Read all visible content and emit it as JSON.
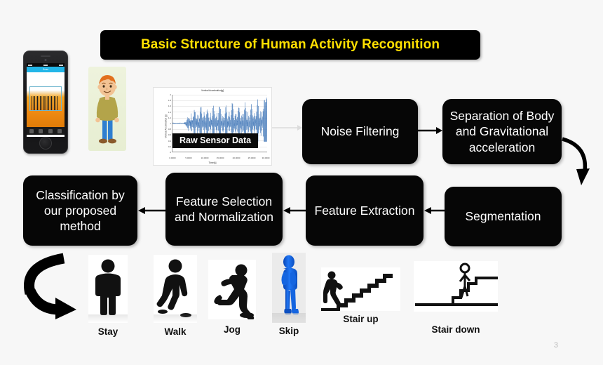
{
  "slide": {
    "title": "Basic Structure of Human Activity Recognition",
    "page_number": "3",
    "background_color": "#f7f7f7",
    "title_bar_color": "#000000",
    "title_text_color": "#ffe000",
    "box_color": "#060606",
    "box_text_color": "#ffffff"
  },
  "inputs": {
    "phone": {
      "name": "smartphone-barcode-scanner",
      "navbar_title": "Scan",
      "screen_bg": "#ffffff",
      "accent": "#23b6e8"
    },
    "person": {
      "name": "cartoon-person",
      "hair_color": "#e2701e",
      "shirt_color": "#b3a44a",
      "pants_color": "#2f7fd0",
      "skin_color": "#f2c394",
      "shoe_color": "#8a5a2b",
      "bg_color": "#e9efd4"
    }
  },
  "chart_data": {
    "type": "line",
    "title": "Vertical Acceleration[g]",
    "xlabel": "Time[s]",
    "ylabel": "Vertical Acceleration [g]",
    "overlay_label": "Raw Sensor Data",
    "series_color": "#4a7ebb",
    "xticks": [
      "0.0000",
      "5.0000",
      "10.0000",
      "15.0000",
      "20.0000",
      "25.0000",
      "30.0000"
    ],
    "yticks": [
      "2",
      "1.8",
      "1.6",
      "1.4",
      "1.2",
      "1",
      "0.8",
      "0.6",
      "0.4",
      "0.2",
      "0"
    ],
    "xlim": [
      0,
      30
    ],
    "ylim": [
      0,
      2
    ],
    "grid": true,
    "description": "Dense oscillating vertical acceleration signal centered near 1 g with periodic peaks up to ~1.8 g and troughs to ~0.6 g",
    "x": [
      0,
      1,
      2,
      3,
      4,
      5,
      6,
      7,
      8,
      9,
      10,
      11,
      12,
      13,
      14,
      15,
      16,
      17,
      18,
      19,
      20,
      21,
      22,
      23,
      24,
      25,
      26,
      27,
      28,
      29,
      30
    ],
    "values": [
      1.0,
      1.0,
      1.02,
      0.98,
      1.05,
      1.25,
      0.78,
      1.42,
      0.7,
      1.5,
      0.68,
      1.48,
      0.72,
      1.52,
      0.66,
      1.55,
      0.7,
      1.5,
      0.68,
      1.58,
      0.65,
      1.52,
      0.7,
      1.6,
      0.66,
      1.55,
      0.68,
      1.62,
      0.64,
      1.58,
      1.7
    ]
  },
  "pipeline": {
    "boxes": [
      {
        "id": "noise-filtering",
        "label": "Noise Filtering"
      },
      {
        "id": "separation",
        "label": "Separation of Body and Gravitational acceleration"
      },
      {
        "id": "segmentation",
        "label": "Segmentation"
      },
      {
        "id": "feature-extraction",
        "label": "Feature Extraction"
      },
      {
        "id": "feature-selection",
        "label": "Feature Selection and Normalization"
      },
      {
        "id": "classification",
        "label": "Classification by our proposed method"
      }
    ]
  },
  "activities": [
    {
      "id": "stay",
      "label": "Stay",
      "icon": "standing-person-silhouette-icon",
      "color": "#111111"
    },
    {
      "id": "walk",
      "label": "Walk",
      "icon": "walking-person-silhouette-icon",
      "color": "#111111"
    },
    {
      "id": "jog",
      "label": "Jog",
      "icon": "running-person-silhouette-icon",
      "color": "#111111"
    },
    {
      "id": "skip",
      "label": "Skip",
      "icon": "skipping-person-3d-icon",
      "color": "#1565e0"
    },
    {
      "id": "stair-up",
      "label": "Stair up",
      "icon": "person-climbing-stairs-icon",
      "color": "#111111"
    },
    {
      "id": "stair-down",
      "label": "Stair down",
      "icon": "person-descending-stairs-icon",
      "color": "#111111"
    }
  ]
}
